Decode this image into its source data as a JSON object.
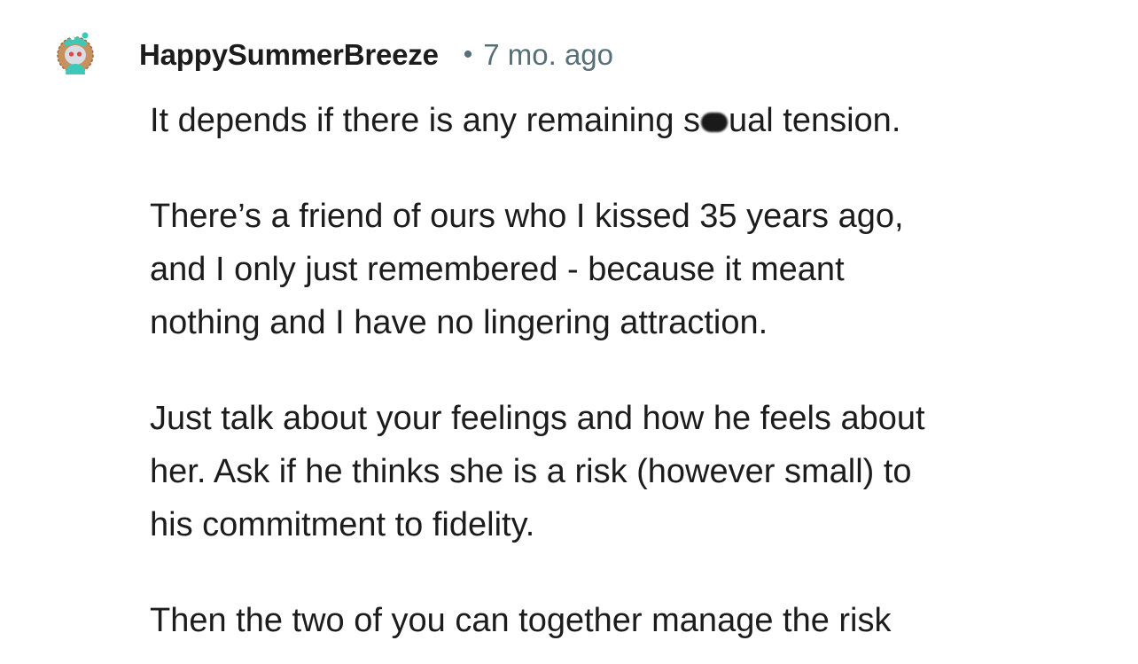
{
  "comment": {
    "username": "HappySummerBreeze",
    "separator": "•",
    "timestamp": "7 mo. ago",
    "avatar": "snoo-avatar-icon",
    "paragraphs": [
      {
        "lines": [
          "It depends if there is any remaining s",
          "ual tension."
        ]
      },
      {
        "lines": [
          "There’s a friend of ours who I kissed 35 years ago,",
          "and I only just remembered - because it meant",
          "nothing and I have no lingering attraction."
        ]
      },
      {
        "lines": [
          "Just talk about your feelings and how he feels about",
          "her. Ask if he thinks she is a risk (however small) to",
          "his commitment to fidelity."
        ]
      },
      {
        "lines": [
          "Then the two of you can together manage the risk"
        ]
      }
    ]
  },
  "colors": {
    "text": "#1c1c1c",
    "meta": "#576f76",
    "avatar_teal": "#3cc9b8",
    "avatar_brown": "#b9855a"
  }
}
